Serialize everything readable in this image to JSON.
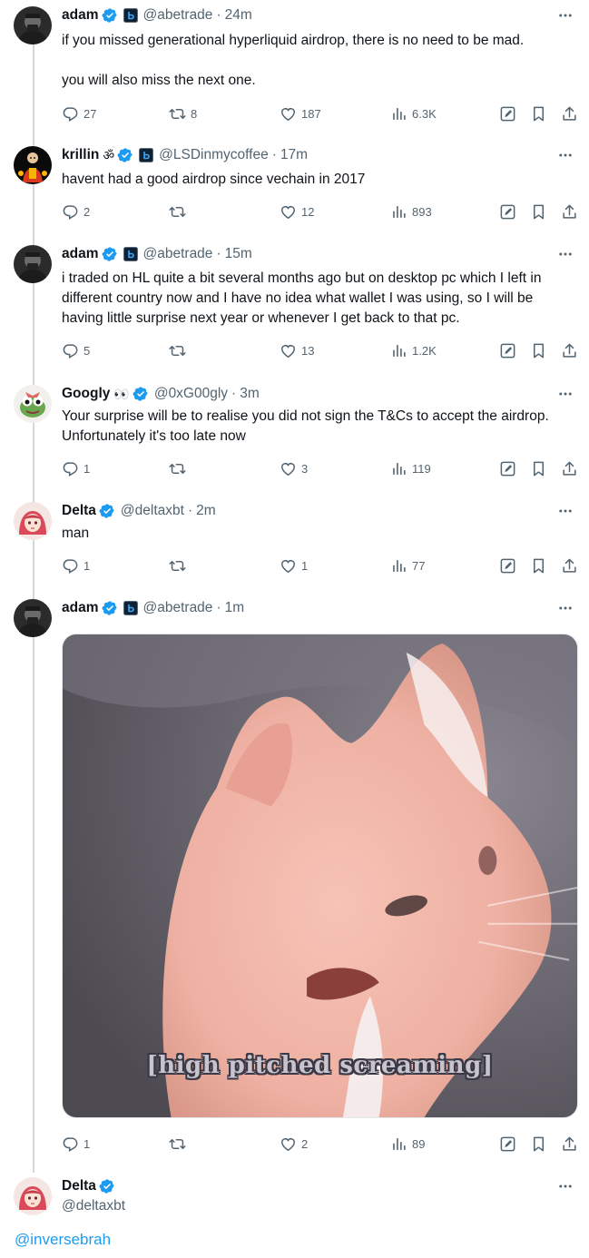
{
  "posts": [
    {
      "name": "adam",
      "handle": "@abetrade",
      "time": "24m",
      "text": "if you missed generational hyperliquid airdrop, there is no need to be mad.\n\nyou will also miss the next one.",
      "replies": "27",
      "reposts": "8",
      "likes": "187",
      "views": "6.3K"
    },
    {
      "name": "krillin",
      "name_emoji": "ॐ",
      "handle": "@LSDinmycoffee",
      "time": "17m",
      "text": "havent had a good airdrop since vechain in 2017",
      "replies": "2",
      "reposts": "",
      "likes": "12",
      "views": "893"
    },
    {
      "name": "adam",
      "handle": "@abetrade",
      "time": "15m",
      "text": "i traded on HL quite a bit several months ago but on desktop pc which I left in different country now and I have no idea what wallet I was using, so I will be having little surprise next year or whenever I get back to that pc.",
      "replies": "5",
      "reposts": "",
      "likes": "13",
      "views": "1.2K"
    },
    {
      "name": "Googly",
      "name_emoji": "👀",
      "handle": "@0xG00gly",
      "time": "3m",
      "text": "Your surprise will be to realise you did not sign the T&Cs to accept the airdrop. Unfortunately it's too late now",
      "replies": "1",
      "reposts": "",
      "likes": "3",
      "views": "119"
    },
    {
      "name": "Delta",
      "handle": "@deltaxbt",
      "time": "2m",
      "text": "man",
      "replies": "1",
      "reposts": "",
      "likes": "1",
      "views": "77"
    },
    {
      "name": "adam",
      "handle": "@abetrade",
      "time": "1m",
      "media_caption": "[high pitched screaming]",
      "replies": "1",
      "reposts": "",
      "likes": "2",
      "views": "89"
    }
  ],
  "composer": {
    "name": "Delta",
    "handle": "@deltaxbt",
    "mention": "@inversebrah"
  },
  "separator": "·",
  "colors": {
    "accent": "#1d9bf0",
    "text": "#0f1419",
    "muted": "#536471",
    "thread_line": "#cfd9de"
  },
  "icons": [
    "verified-badge-icon",
    "affiliate-badge-icon",
    "more-icon",
    "reply-icon",
    "repost-icon",
    "like-icon",
    "views-icon",
    "edit-icon",
    "bookmark-icon",
    "share-icon"
  ]
}
